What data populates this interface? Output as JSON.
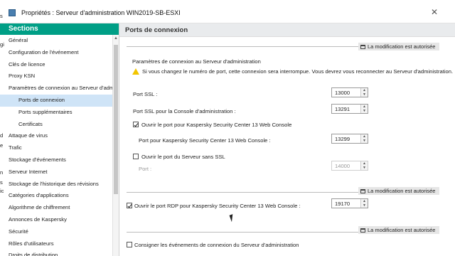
{
  "window": {
    "title": "Propriétés : Serveur d'administration WIN2019-SB-ESXI",
    "close_glyph": "✕"
  },
  "sidebar": {
    "heading": "Sections",
    "items": [
      {
        "label": "Général"
      },
      {
        "label": "Configuration de l'événement"
      },
      {
        "label": "Clés de licence"
      },
      {
        "label": "Proxy KSN"
      },
      {
        "label": "Paramètres de connexion au Serveur d'adm"
      },
      {
        "label": "Ports de connexion"
      },
      {
        "label": "Ports supplémentaires"
      },
      {
        "label": "Certificats"
      },
      {
        "label": "Attaque de virus"
      },
      {
        "label": "Trafic"
      },
      {
        "label": "Stockage d'événements"
      },
      {
        "label": "Serveur Internet"
      },
      {
        "label": "Stockage de l'historique des révisions"
      },
      {
        "label": "Catégories d'applications"
      },
      {
        "label": "Algorithme de chiffrement"
      },
      {
        "label": "Annonces de Kaspersky"
      },
      {
        "label": "Sécurité"
      },
      {
        "label": "Rôles d'utilisateurs"
      },
      {
        "label": "Droits de distribution"
      }
    ],
    "left_fragments": [
      "s",
      "gi",
      "d",
      "e",
      "n",
      "s",
      "ic"
    ]
  },
  "main": {
    "header": "Ports de connexion",
    "badge": "La modification est autorisée",
    "section_title": "Paramètres de connexion au Serveur d'administration",
    "warning": "Si vous changez le numéro de port, cette connexion sera interrompue. Vous devrez vous reconnecter au Serveur d'administration.",
    "port_ssl": {
      "label": "Port SSL :",
      "value": "13000"
    },
    "port_ssl_console": {
      "label": "Port SSL pour la Console d'administration :",
      "value": "13291"
    },
    "open_web_console": {
      "label": "Ouvrir le port pour Kaspersky Security Center 13 Web Console",
      "checked": true
    },
    "web_console_port": {
      "label": "Port pour Kaspersky Security Center 13 Web Console :",
      "value": "13299"
    },
    "open_no_ssl": {
      "label": "Ouvrir le port du Serveur sans SSL",
      "checked": false
    },
    "port_no_ssl": {
      "label": "Port :",
      "value": "14000"
    },
    "rdp_port": {
      "label": "Ouvrir le port RDP pour Kaspersky Security Center 13 Web Console :",
      "checked": true,
      "value": "19170"
    },
    "log_events": {
      "label": "Consigner les événements de connexion du Serveur d'administration",
      "checked": false
    }
  }
}
